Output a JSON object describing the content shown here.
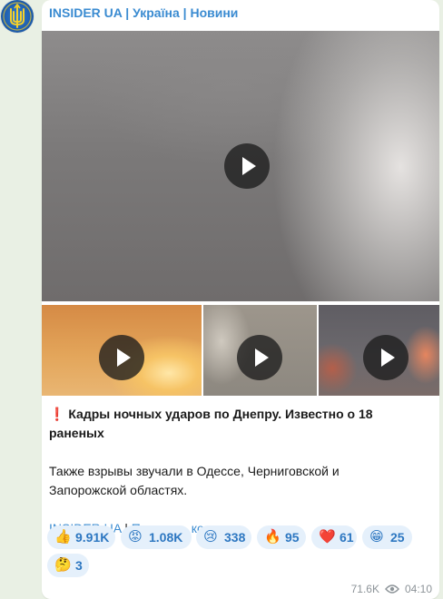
{
  "post": {
    "channel_line": "INSIDER UA | Україна | Новини",
    "headline_mark": "❗",
    "headline": " Кадры ночных ударов по Днепру. Известно о 18 раненых",
    "body_line1": "Также взрывы звучали в Одессе, Черниговской и",
    "body_line2": "Запорожской областях.",
    "link_channel": "INSIDER UA",
    "link_separator": " | ",
    "link_submit": "Прислать контент",
    "views": "71.6K",
    "time": "04:10"
  },
  "media": {
    "tiles": [
      "video",
      "video",
      "video",
      "video"
    ],
    "play_icon": "play-icon"
  },
  "reactions": [
    {
      "emoji": "👍",
      "icon": "thumbs-up-icon",
      "count": "9.91K"
    },
    {
      "emoji": "😡",
      "icon": "angry-face-icon",
      "count": "1.08K"
    },
    {
      "emoji": "😢",
      "icon": "crying-face-icon",
      "count": "338"
    },
    {
      "emoji": "🔥",
      "icon": "fire-icon",
      "count": "95"
    },
    {
      "emoji": "❤️",
      "icon": "heart-icon",
      "count": "61"
    },
    {
      "emoji": "😁",
      "icon": "grinning-face-icon",
      "count": "25"
    },
    {
      "emoji": "🤔",
      "icon": "thinking-face-icon",
      "count": "3"
    }
  ],
  "colors": {
    "background": "#e9f0e4",
    "link": "#3a8bd1",
    "reaction_bg": "#e5f0fb",
    "reaction_text": "#2d77c1"
  }
}
